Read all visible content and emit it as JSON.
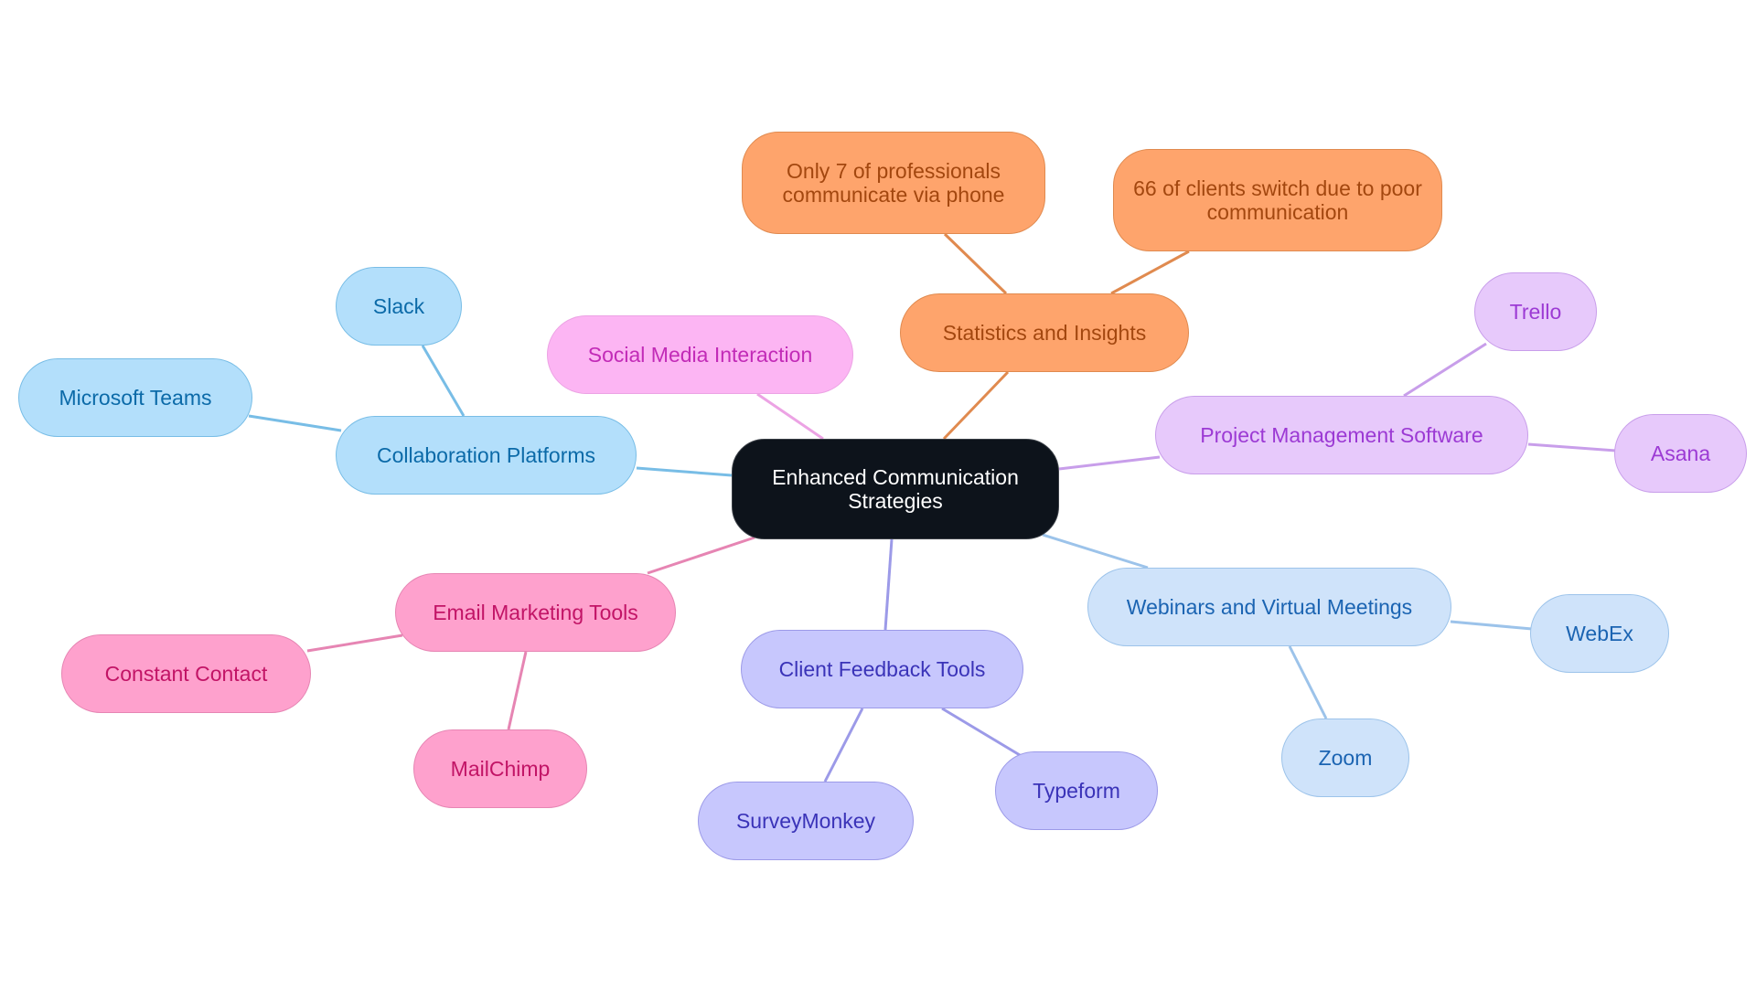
{
  "title": "Enhanced Communication Strategies",
  "root": {
    "id": "root",
    "label": "Enhanced Communication Strategies",
    "color": "#0d131b",
    "text": "#ffffff",
    "border": "#3a3f46"
  },
  "branches": [
    {
      "id": "collab",
      "label": "Collaboration Platforms",
      "fill": "#b3dffb",
      "text": "#0b6aa8",
      "stroke": "#78bde6",
      "children": [
        {
          "id": "slack",
          "label": "Slack"
        },
        {
          "id": "msteams",
          "label": "Microsoft Teams"
        }
      ]
    },
    {
      "id": "social",
      "label": "Social Media Interaction",
      "fill": "#fcb5f3",
      "text": "#c22bb7",
      "stroke": "#eca3e4",
      "children": []
    },
    {
      "id": "stats",
      "label": "Statistics and Insights",
      "fill": "#fea46c",
      "text": "#a3470f",
      "stroke": "#e08a4f",
      "children": [
        {
          "id": "only7",
          "label": "Only 7 of professionals communicate via phone"
        },
        {
          "id": "sixty6",
          "label": "66 of clients switch due to poor communication"
        }
      ]
    },
    {
      "id": "pm",
      "label": "Project Management Software",
      "fill": "#e7c9fb",
      "text": "#9c3ad4",
      "stroke": "#c89eea",
      "children": [
        {
          "id": "trello",
          "label": "Trello"
        },
        {
          "id": "asana",
          "label": "Asana"
        }
      ]
    },
    {
      "id": "webinar",
      "label": "Webinars and Virtual Meetings",
      "fill": "#cfe3fa",
      "text": "#1b64b2",
      "stroke": "#9cc3ea",
      "children": [
        {
          "id": "webex",
          "label": "WebEx"
        },
        {
          "id": "zoom",
          "label": "Zoom"
        }
      ]
    },
    {
      "id": "feedback",
      "label": "Client Feedback Tools",
      "fill": "#c7c7fd",
      "text": "#3a33b8",
      "stroke": "#9c9ae8",
      "children": [
        {
          "id": "surveymonkey",
          "label": "SurveyMonkey"
        },
        {
          "id": "typeform",
          "label": "Typeform"
        }
      ]
    },
    {
      "id": "email",
      "label": "Email Marketing Tools",
      "fill": "#fea1cd",
      "text": "#c21466",
      "stroke": "#e685b3",
      "children": [
        {
          "id": "constant",
          "label": "Constant Contact"
        },
        {
          "id": "mailchimp",
          "label": "MailChimp"
        }
      ]
    }
  ]
}
